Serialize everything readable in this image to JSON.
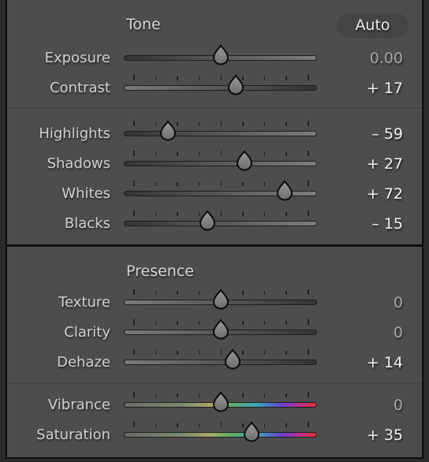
{
  "tone": {
    "title": "Tone",
    "auto_label": "Auto",
    "sliders": [
      {
        "label": "Exposure",
        "value_text": "0.00",
        "value": 0,
        "min": -5,
        "max": 5,
        "ticks": false,
        "track": "dark-to-light"
      },
      {
        "label": "Contrast",
        "value_text": "+ 17",
        "value": 17,
        "min": -100,
        "max": 100,
        "ticks": true,
        "track": "light-to-dark"
      },
      {
        "label": "Highlights",
        "value_text": "– 59",
        "value": -59,
        "min": -100,
        "max": 100,
        "ticks": true,
        "track": "dark-to-light"
      },
      {
        "label": "Shadows",
        "value_text": "+ 27",
        "value": 27,
        "min": -100,
        "max": 100,
        "ticks": true,
        "track": "dark-to-light"
      },
      {
        "label": "Whites",
        "value_text": "+ 72",
        "value": 72,
        "min": -100,
        "max": 100,
        "ticks": true,
        "track": "dark-to-light"
      },
      {
        "label": "Blacks",
        "value_text": "– 15",
        "value": -15,
        "min": -100,
        "max": 100,
        "ticks": true,
        "track": "dark-to-light"
      }
    ]
  },
  "presence": {
    "title": "Presence",
    "sliders": [
      {
        "label": "Texture",
        "value_text": "0",
        "value": 0,
        "min": -100,
        "max": 100,
        "ticks": true,
        "track": "light-to-dark"
      },
      {
        "label": "Clarity",
        "value_text": "0",
        "value": 0,
        "min": -100,
        "max": 100,
        "ticks": true,
        "track": "light-to-dark"
      },
      {
        "label": "Dehaze",
        "value_text": "+ 14",
        "value": 14,
        "min": -100,
        "max": 100,
        "ticks": true,
        "track": "light-to-dark"
      },
      {
        "label": "Vibrance",
        "value_text": "0",
        "value": 0,
        "min": -100,
        "max": 100,
        "ticks": true,
        "track": "spectrum"
      },
      {
        "label": "Saturation",
        "value_text": "+ 35",
        "value": 35,
        "min": -100,
        "max": 100,
        "ticks": true,
        "track": "spectrum"
      }
    ]
  },
  "colors": {
    "panel_bg": "#4d4d4d",
    "border": "#0e0e0e",
    "value_nonzero": "#f0f0f0",
    "value_zero": "#a6a6a6"
  }
}
